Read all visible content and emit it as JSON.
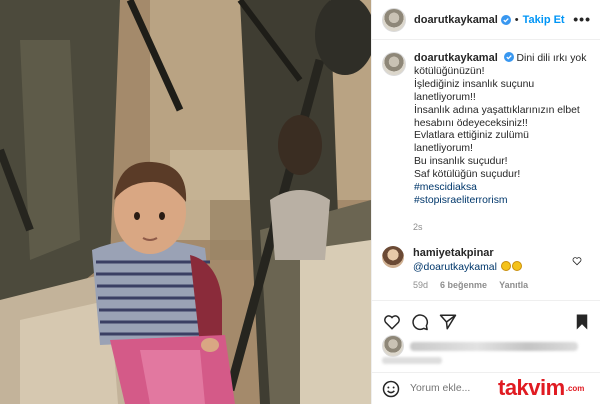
{
  "post": {
    "username": "doarutkaykamal",
    "follow_label": "Takip Et",
    "separator": "•",
    "more_label": "•••",
    "caption_lines": [
      "Dini dili ırkı yok",
      "kötülüğünüzün!",
      "İşlediğiniz insanlık suçunu",
      "lanetliyorum!!",
      "İnsanlık adına yaşattıklarınızın elbet",
      "hesabını ödeyeceksiniz!!",
      "Evlatlara ettiğiniz zulümü",
      "lanetliyorum!",
      "Bu insanlık suçudur!",
      "Saf kötülüğün suçudur!"
    ],
    "hashtags": [
      "#mescidiaksa",
      "#stopisraeliterrorism"
    ],
    "time_ago": "2s"
  },
  "comment": {
    "username": "hamiyetakpinar",
    "mention": "@doarutkaykamal",
    "time_ago": "59d",
    "likes": "6 beğenme",
    "reply_label": "Yanıtla"
  },
  "composer": {
    "placeholder": "Yorum ekle..."
  },
  "watermark": {
    "brand": "takvim",
    "suffix": ".com"
  },
  "colors": {
    "link_blue": "#0095f6",
    "hashtag": "#00376b",
    "muted": "#8e8e8e",
    "watermark_red": "#e01b22"
  },
  "icons": {
    "verified": "verified-badge-icon",
    "heart": "heart-icon",
    "comment": "comment-icon",
    "share": "share-icon",
    "bookmark": "bookmark-icon",
    "emoji": "emoji-icon"
  }
}
